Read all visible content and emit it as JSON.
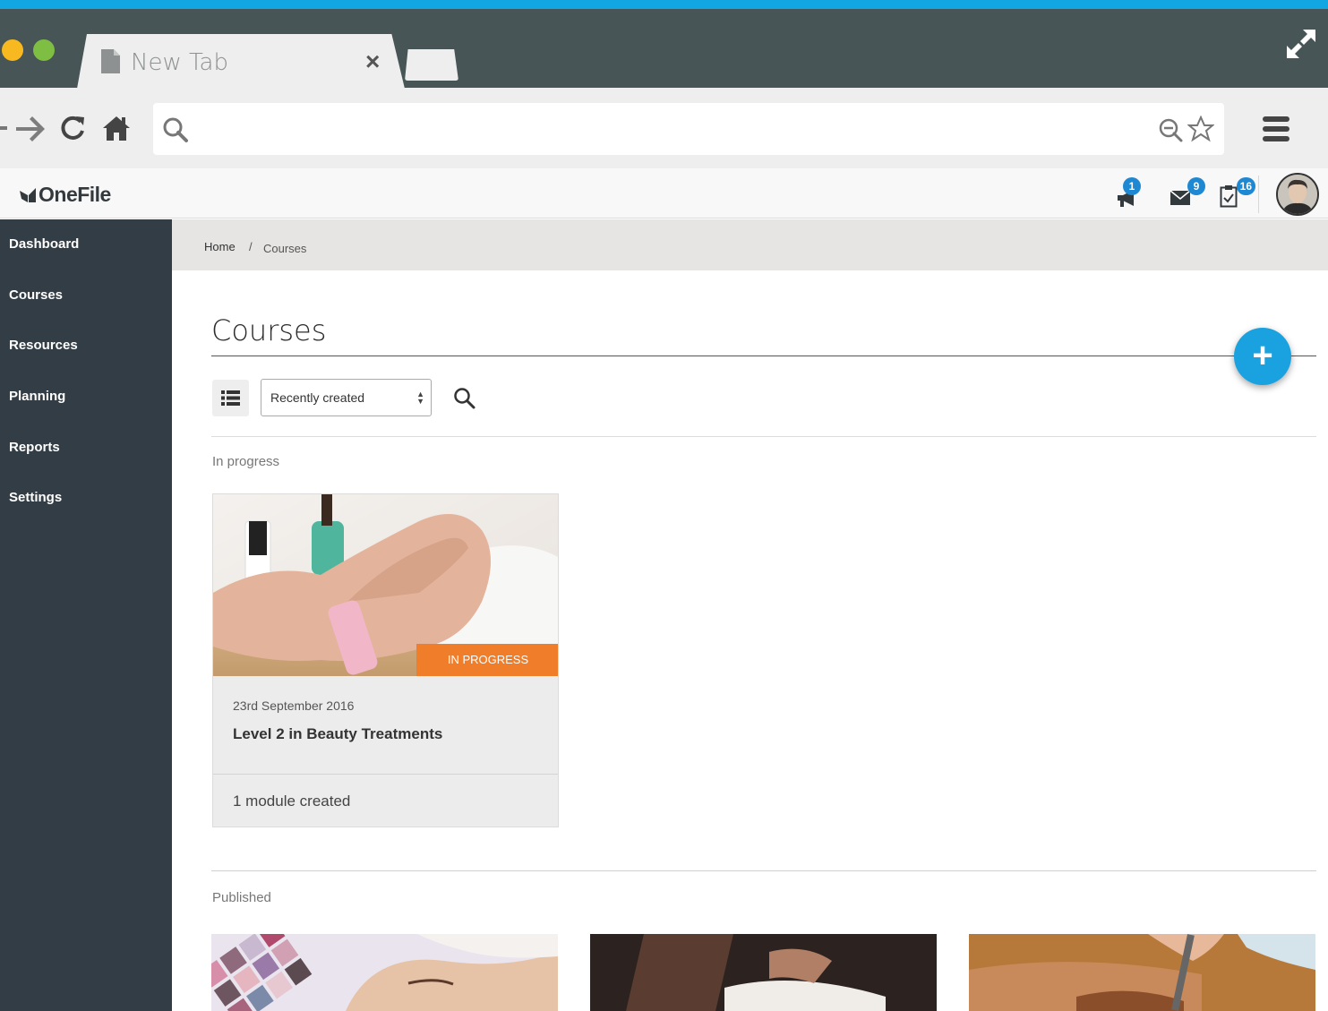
{
  "browser": {
    "tab_title": "New Tab",
    "tab_close": "×"
  },
  "app": {
    "logo_text": "OneFile",
    "notifications": [
      {
        "name": "announcements",
        "count": "1"
      },
      {
        "name": "messages",
        "count": "9"
      },
      {
        "name": "tasks",
        "count": "16"
      }
    ]
  },
  "sidebar": {
    "items": [
      {
        "label": "Dashboard"
      },
      {
        "label": "Courses"
      },
      {
        "label": "Resources"
      },
      {
        "label": "Planning"
      },
      {
        "label": "Reports"
      },
      {
        "label": "Settings"
      }
    ]
  },
  "breadcrumb": {
    "home": "Home",
    "separator": "/",
    "current": "Courses"
  },
  "page": {
    "title": "Courses",
    "add_label": "+",
    "sort_selected": "Recently created"
  },
  "sections": {
    "in_progress": {
      "label": "In progress",
      "card": {
        "status": "IN PROGRESS",
        "date": "23rd September 2016",
        "title": "Level 2 in Beauty Treatments",
        "modules": "1 module created"
      }
    },
    "published": {
      "label": "Published"
    }
  },
  "colors": {
    "accent": "#1aa1df",
    "sidebar": "#333d45",
    "status_in_progress": "#ef7d2a",
    "badge": "#1e88d2"
  },
  "icons": [
    "document-icon",
    "close-icon",
    "expand-icon",
    "back-arrow-icon",
    "forward-arrow-icon",
    "reload-icon",
    "home-icon",
    "search-icon",
    "zoom-out-icon",
    "star-icon",
    "menu-icon",
    "megaphone-icon",
    "envelope-icon",
    "clipboard-check-icon",
    "list-view-icon",
    "plus-icon"
  ]
}
